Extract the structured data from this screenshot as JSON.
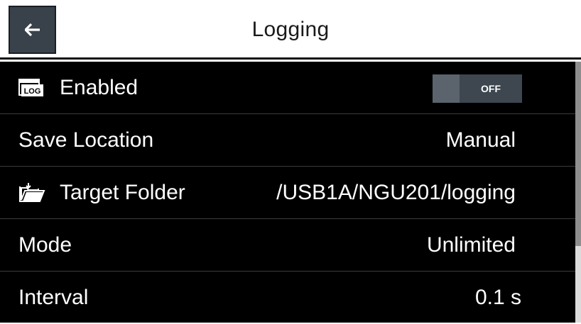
{
  "header": {
    "title": "Logging",
    "back_icon": "arrow-left-icon"
  },
  "rows": [
    {
      "label": "Enabled",
      "icon": "log-icon",
      "control": "toggle",
      "toggle_state": "OFF"
    },
    {
      "label": "Save Location",
      "value": "Manual"
    },
    {
      "label": "Target Folder",
      "icon": "folder-open-icon",
      "value": "/USB1A/NGU201/logging"
    },
    {
      "label": "Mode",
      "value": "Unlimited"
    },
    {
      "label": "Interval",
      "value": "0.1 s"
    }
  ],
  "colors": {
    "list_background": "#000000",
    "row_divider": "#3c3c3c",
    "back_button": "#39424b",
    "toggle_off": "#3e4750"
  }
}
